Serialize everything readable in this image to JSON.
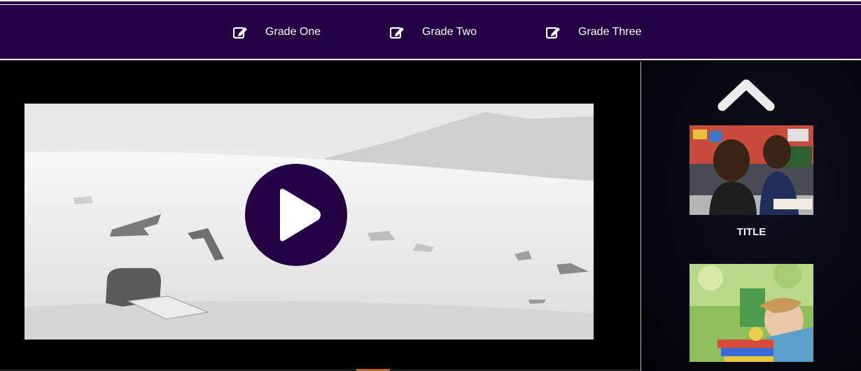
{
  "nav": {
    "items": [
      {
        "label": "Grade One",
        "icon": "edit-icon"
      },
      {
        "label": "Grade Two",
        "icon": "edit-icon"
      },
      {
        "label": "Grade Three",
        "icon": "edit-icon"
      }
    ]
  },
  "video": {
    "play_icon": "play-icon"
  },
  "sidebar": {
    "scroll_up_icon": "chevron-up-icon",
    "cards": [
      {
        "title": "TITLE"
      },
      {
        "title": ""
      }
    ]
  },
  "colors": {
    "brand_purple": "#240044",
    "background": "#000000",
    "text": "#ffffff"
  }
}
